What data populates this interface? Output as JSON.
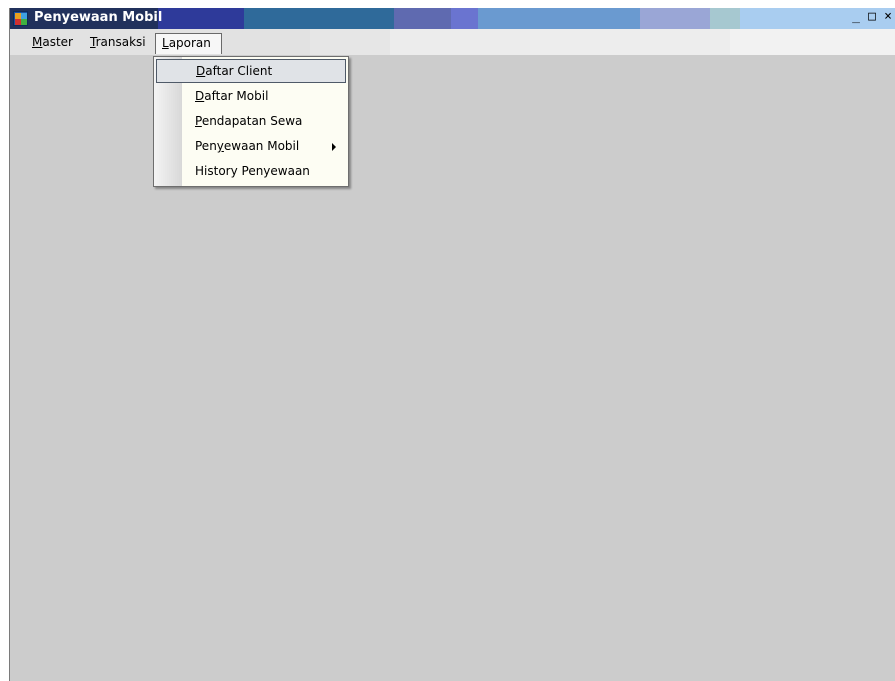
{
  "window": {
    "title": "Penyewaan Mobil",
    "buttons": {
      "minimize": "_",
      "maximize": "□",
      "close": "×"
    }
  },
  "menubar": {
    "items": [
      {
        "label": "Master",
        "mnemonic": "M",
        "rest": "aster"
      },
      {
        "label": "Transaksi",
        "mnemonic": "T",
        "rest": "ransaksi"
      },
      {
        "label": "Laporan",
        "mnemonic": "L",
        "rest": "aporan"
      }
    ]
  },
  "laporan_menu": {
    "items": [
      {
        "label": "Daftar Client",
        "pre": "",
        "mnemonic": "D",
        "rest": "aftar Client"
      },
      {
        "label": "Daftar Mobil",
        "pre": "",
        "mnemonic": "D",
        "rest": "aftar Mobil"
      },
      {
        "label": "Pendapatan Sewa",
        "pre": "",
        "mnemonic": "P",
        "rest": "endapatan Sewa"
      },
      {
        "label": "Penyewaan Mobil",
        "pre": "Pen",
        "mnemonic": "y",
        "rest": "ewaan Mobil"
      },
      {
        "label": "History Penyewaan",
        "pre": "",
        "mnemonic": "",
        "rest": "History Penyewaan"
      }
    ]
  }
}
